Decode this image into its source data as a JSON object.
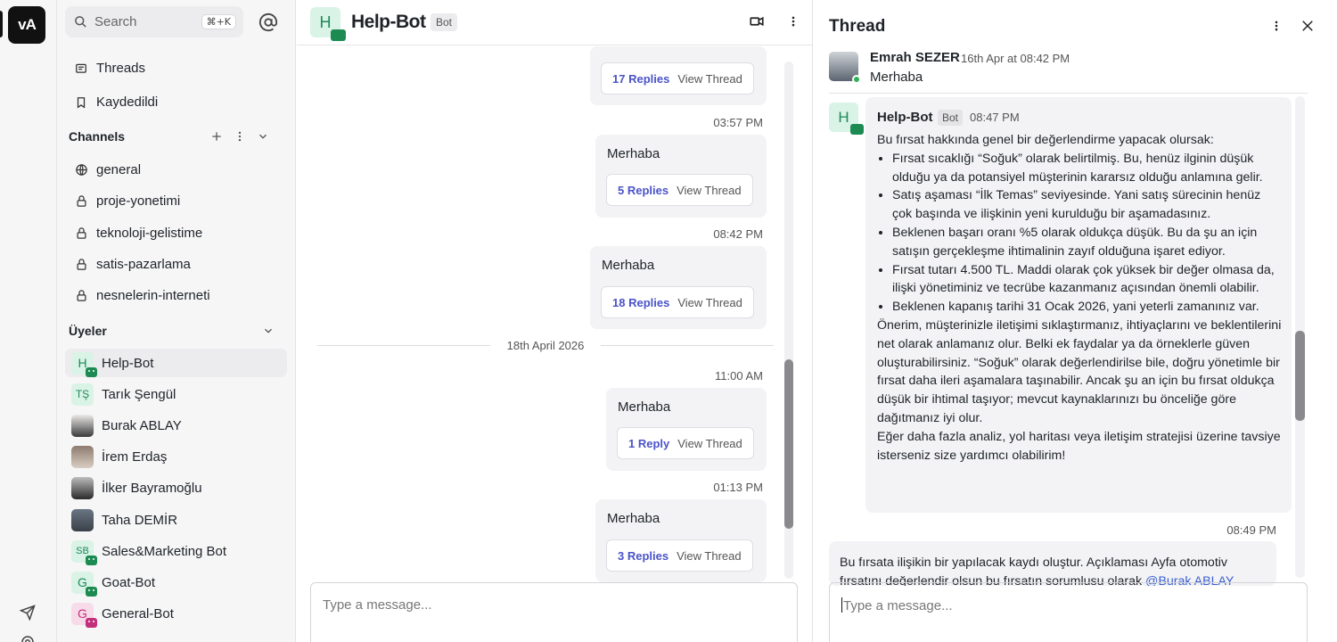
{
  "rail": {
    "logo": "vA"
  },
  "sidebar": {
    "search": {
      "placeholder": "Search",
      "shortcut": "⌘+K"
    },
    "nav": [
      {
        "label": "Threads"
      },
      {
        "label": "Kaydedildi"
      }
    ],
    "channels_title": "Channels",
    "channels": [
      {
        "label": "general",
        "icon": "globe-icon"
      },
      {
        "label": "proje-yonetimi",
        "icon": "lock-icon"
      },
      {
        "label": "teknoloji-gelistime",
        "icon": "lock-icon"
      },
      {
        "label": "satis-pazarlama",
        "icon": "lock-icon"
      },
      {
        "label": "nesnelerin-interneti",
        "icon": "lock-icon"
      }
    ],
    "members_title": "Üyeler",
    "members": [
      {
        "label": "Help-Bot",
        "avatar": "H"
      },
      {
        "label": "Tarık Şengül",
        "avatar": "TŞ"
      },
      {
        "label": "Burak ABLAY",
        "avatar": ""
      },
      {
        "label": "İrem Erdaş",
        "avatar": ""
      },
      {
        "label": "İlker Bayramoğlu",
        "avatar": ""
      },
      {
        "label": "Taha DEMİR",
        "avatar": ""
      },
      {
        "label": "Sales&Marketing Bot",
        "avatar": "SB"
      },
      {
        "label": "Goat-Bot",
        "avatar": "G"
      },
      {
        "label": "General-Bot",
        "avatar": "G"
      }
    ]
  },
  "chat": {
    "avatar": "H",
    "title": "Help-Bot",
    "tag": "Bot",
    "messages": [
      {
        "time": "",
        "text": "",
        "replies": "17 Replies",
        "view": "View Thread"
      },
      {
        "time": "03:57 PM",
        "text": "Merhaba",
        "replies": "5 Replies",
        "view": "View Thread"
      },
      {
        "time": "08:42 PM",
        "text": "Merhaba",
        "replies": "18 Replies",
        "view": "View Thread"
      },
      {
        "time": "11:00 AM",
        "text": "Merhaba",
        "replies": "1 Reply",
        "view": "View Thread"
      },
      {
        "time": "01:13 PM",
        "text": "Merhaba",
        "replies": "3 Replies",
        "view": "View Thread"
      }
    ],
    "date_divider": "18th April 2026",
    "composer_placeholder": "Type a message..."
  },
  "thread": {
    "title": "Thread",
    "parent": {
      "name": "Emrah SEZER",
      "time": "16th Apr at 08:42 PM",
      "text": "Merhaba"
    },
    "bot": {
      "avatar": "H",
      "name": "Help-Bot",
      "tag": "Bot",
      "time": "08:47 PM",
      "intro": "Bu fırsat hakkında genel bir değerlendirme yapacak olursak:",
      "bullets": [
        "Fırsat sıcaklığı “Soğuk” olarak belirtilmiş. Bu, henüz ilginin düşük olduğu ya da potansiyel müşterinin kararsız olduğu anlamına gelir.",
        "Satış aşaması “İlk Temas” seviyesinde. Yani satış sürecinin henüz çok başında ve ilişkinin yeni kurulduğu bir aşamadasınız.",
        "Beklenen başarı oranı %5 olarak oldukça düşük. Bu da şu an için satışın gerçekleşme ihtimalinin zayıf olduğuna işaret ediyor.",
        "Fırsat tutarı 4.500 TL. Maddi olarak çok yüksek bir değer olmasa da, ilişki yönetiminiz ve tecrübe kazanmanız açısından önemli olabilir.",
        "Beklenen kapanış tarihi 31 Ocak 2026, yani yeterli zamanınız var."
      ],
      "para1": "Önerim, müşterinizle iletişimi sıklaştırmanız, ihtiyaçlarını ve beklentilerini net olarak anlamanız olur. Belki ek faydalar ya da örneklerle güven oluşturabilirsiniz. “Soğuk” olarak değerlendirilse bile, doğru yönetimle bir fırsat daha ileri aşamalara taşınabilir. Ancak şu an için bu fırsat oldukça düşük bir ihtimal taşıyor; mevcut kaynaklarınızı bu önceliğe göre dağıtmanız iyi olur.",
      "para2": "Eğer daha fazla analiz, yol haritası veya iletişim stratejisi üzerine tavsiye isterseniz size yardımcı olabilirim!"
    },
    "user_time": "08:49 PM",
    "user_text": "Bu fırsata ilişikin bir yapılacak kaydı oluştur. Açıklaması Ayfa otomotiv fırsatını değerlendir olsun bu fırsatın sorumlusu olarak",
    "user_mention": "@Burak ABLAY",
    "composer_placeholder": "Type a message..."
  }
}
